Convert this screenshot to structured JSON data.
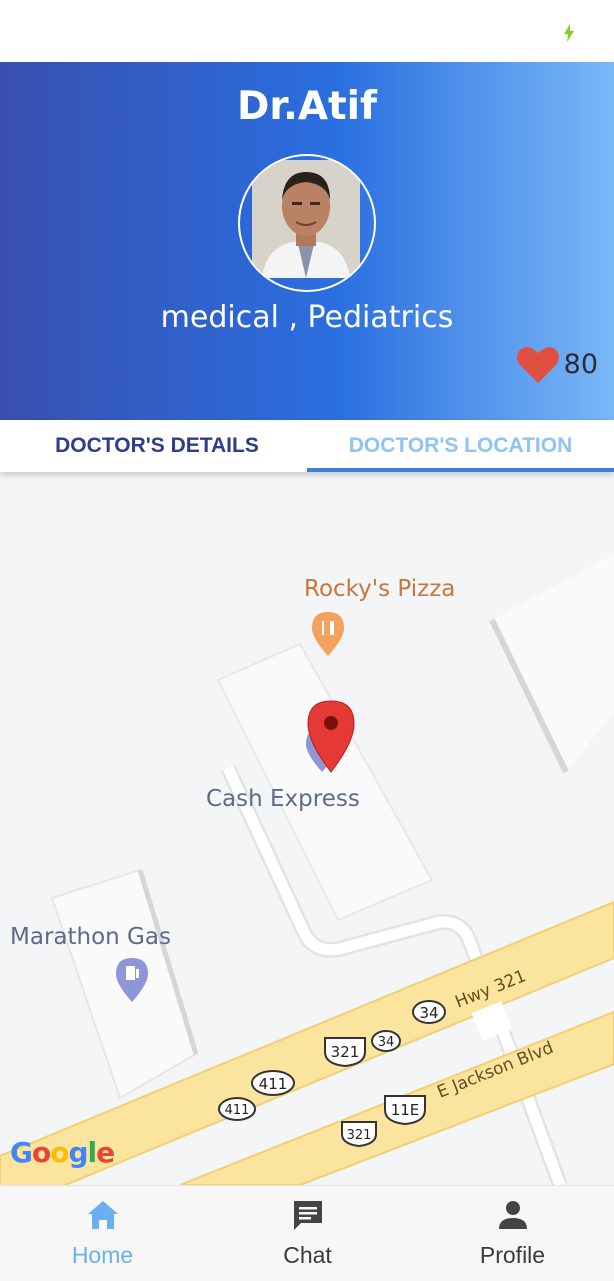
{
  "doctor": {
    "name": "Dr.Atif",
    "specialty": "medical , Pediatrics",
    "likes": "80"
  },
  "tabs": [
    {
      "label": "DOCTOR'S DETAILS",
      "active": false
    },
    {
      "label": "DOCTOR'S LOCATION",
      "active": true
    }
  ],
  "map": {
    "places": {
      "rocky": "Rocky's Pizza",
      "cash": "Cash Express",
      "marathon": "Marathon Gas"
    },
    "roads": {
      "hwy": "Hwy 321",
      "jackson": "E Jackson Blvd"
    },
    "shields": {
      "s34a": "34",
      "s34b": "34",
      "s321a": "321",
      "s321b": "321",
      "s411a": "411",
      "s411b": "411",
      "s11e": "11E"
    },
    "attribution": "Google"
  },
  "nav": [
    {
      "label": "Home",
      "icon": "home-icon",
      "active": true
    },
    {
      "label": "Chat",
      "icon": "chat-icon",
      "active": false
    },
    {
      "label": "Profile",
      "icon": "person-icon",
      "active": false
    }
  ],
  "colors": {
    "header_gradient_start": "#3a4fb0",
    "header_gradient_end": "#7ab8f7",
    "tab_active": "#8fc3f2",
    "tab_inactive": "#2f3c8a",
    "heart": "#e05040",
    "nav_active": "#6ab0f0",
    "marker": "#e53935"
  }
}
